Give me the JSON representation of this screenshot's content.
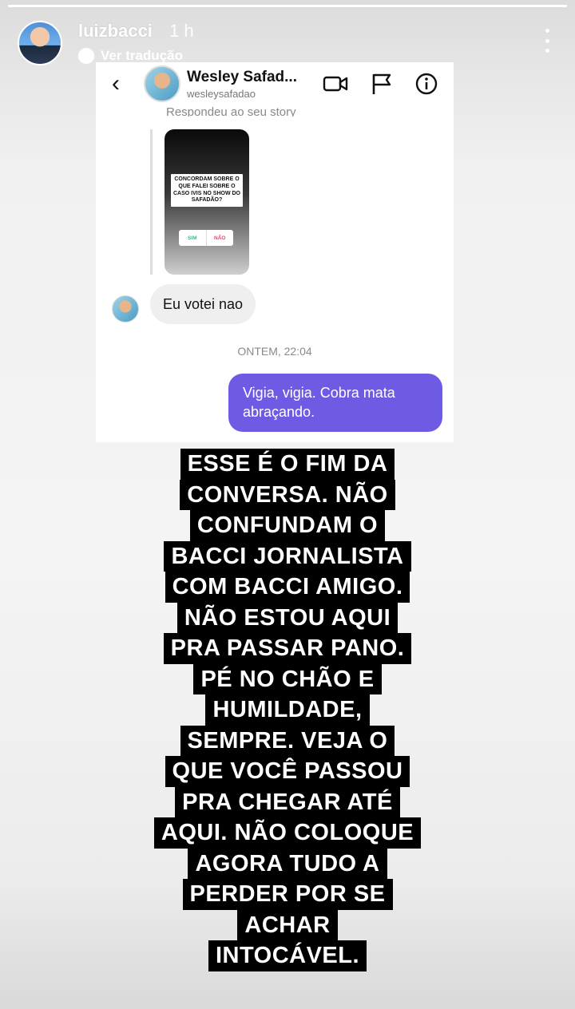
{
  "story": {
    "progress": 1.0,
    "username": "luizbacci",
    "time": "1 h",
    "translate_label": "Ver tradução",
    "more_icon": "more-vertical-icon"
  },
  "dm": {
    "contact_name": "Wesley Safad...",
    "contact_handle": "wesleysafadao",
    "replied_label": "Respondeu ao seu story",
    "story_thumbnail": {
      "question": "CONCORDAM SOBRE O QUE FALEI SOBRE O CASO IVIS NO SHOW DO SAFADÃO?",
      "poll_yes": "SIM",
      "poll_no": "NÃO"
    },
    "incoming_message": "Eu votei nao",
    "date_separator": "ONTEM, 22:04",
    "outgoing_message": "Vigia, vigia. Cobra mata abraçando.",
    "colors": {
      "outgoing_bubble": "#6d5be4",
      "incoming_bubble": "#efefef"
    }
  },
  "caption": {
    "lines": [
      "ESSE É O FIM DA",
      "CONVERSA. NÃO",
      "CONFUNDAM O",
      "BACCI JORNALISTA",
      "COM BACCI AMIGO.",
      "NÃO ESTOU AQUI",
      "PRA PASSAR PANO.",
      "PÉ NO CHÃO E",
      "HUMILDADE,",
      "SEMPRE. VEJA O",
      "QUE VOCÊ PASSOU",
      "PRA CHEGAR ATÉ",
      "AQUI. NÃO COLOQUE",
      "AGORA TUDO A",
      "PERDER POR SE",
      "ACHAR",
      "INTOCÁVEL."
    ]
  }
}
